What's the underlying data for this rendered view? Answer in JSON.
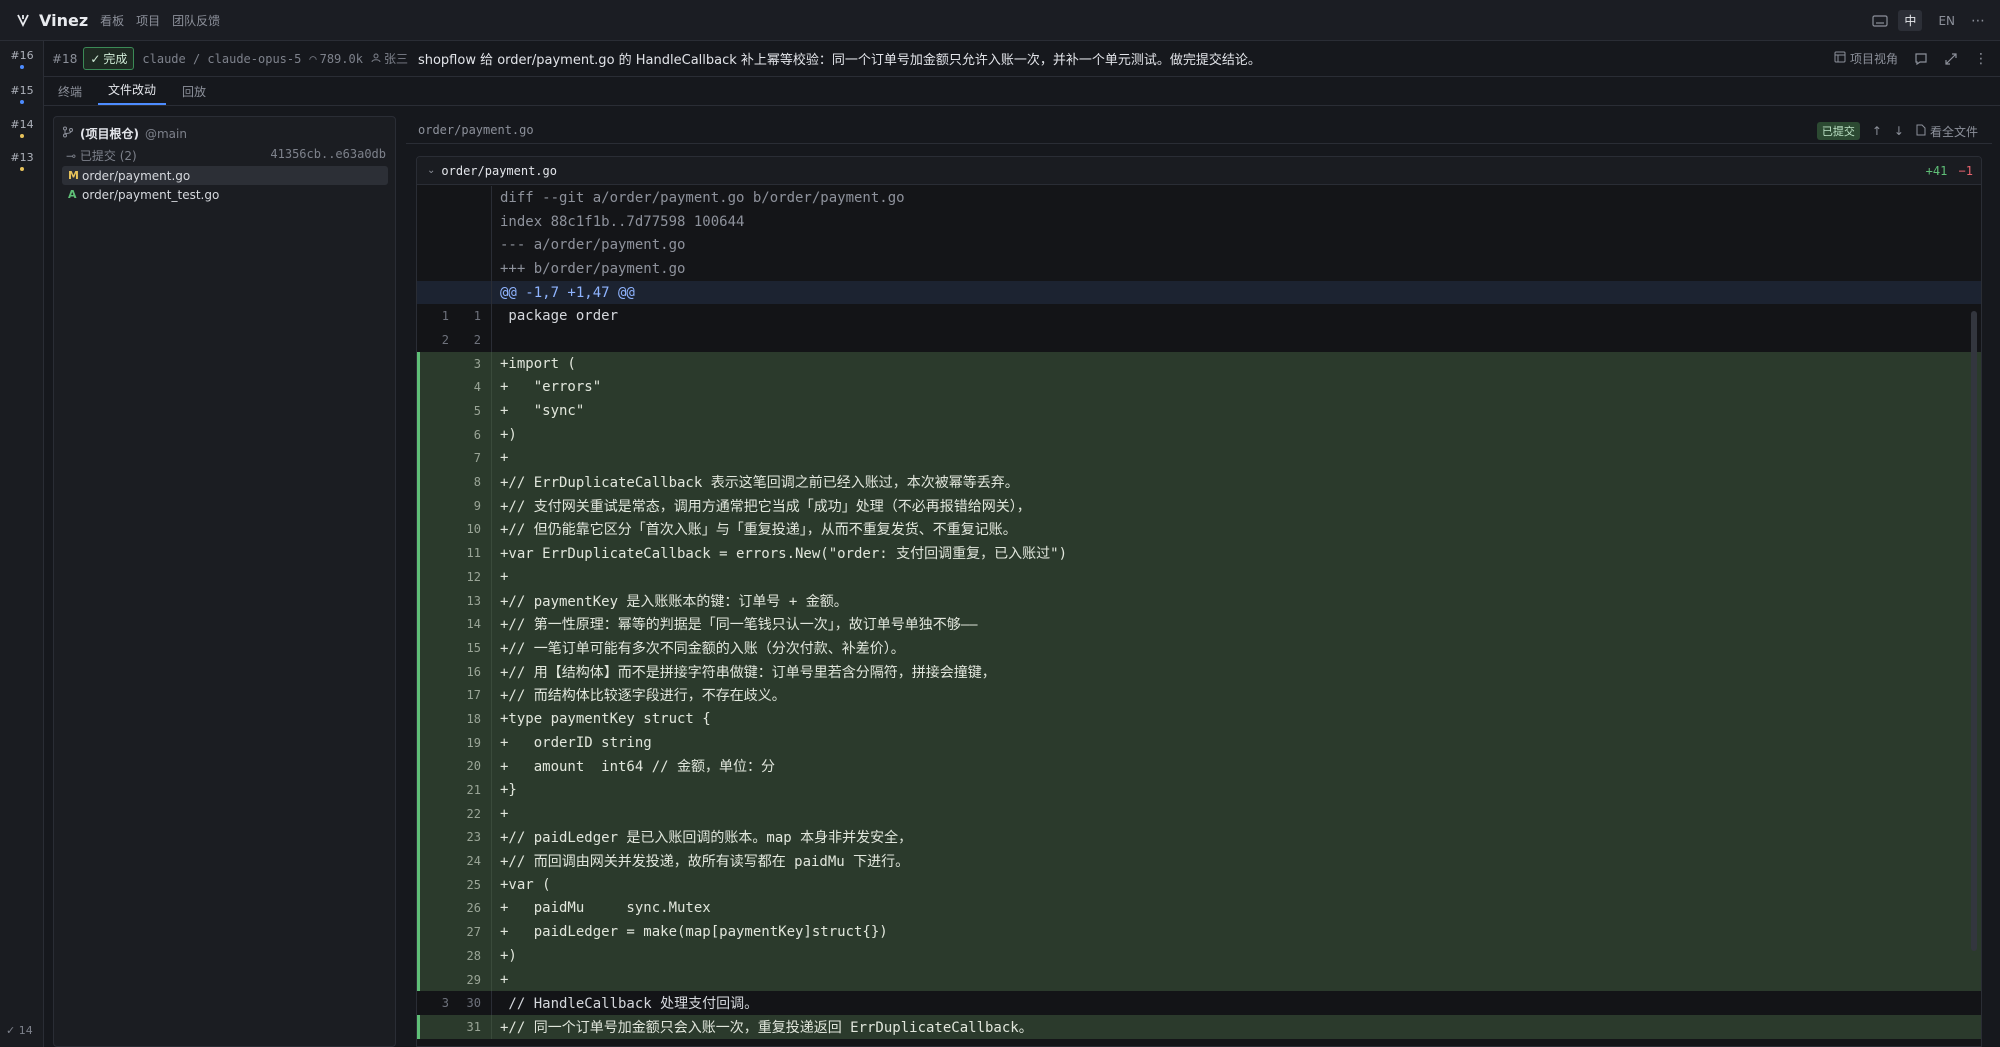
{
  "app": {
    "name": "Vinez",
    "nav": [
      "看板",
      "项目",
      "团队反馈"
    ],
    "lang_zh": "中",
    "lang_en": "EN"
  },
  "rail": {
    "items": [
      {
        "label": "#16",
        "dot": "#4d8cff"
      },
      {
        "label": "#15",
        "dot": "#4d8cff"
      },
      {
        "label": "#14",
        "dot": "#e6c15a"
      },
      {
        "label": "#13",
        "dot": "#e6c15a"
      }
    ],
    "count": "✓ 14"
  },
  "task": {
    "id": "#18",
    "status": "完成",
    "agent_path": "claude / claude-opus-5",
    "tokens": "789.0k",
    "owner": "张三",
    "title": "shopflow 给 order/payment.go 的 HandleCallback 补上幂等校验：同一个订单号加金额只允许入账一次，并补一个单元测试。做完提交结论。",
    "project_view": "项目视角"
  },
  "tabs": [
    "终端",
    "文件改动",
    "回放"
  ],
  "tree": {
    "root_name": "(项目根仓)",
    "branch": "@main",
    "commit_label": "已提交 (2)",
    "commit_range": "41356cb..e63a0db",
    "files": [
      {
        "status": "M",
        "name": "order/payment.go",
        "color": "#e6c15a"
      },
      {
        "status": "A",
        "name": "order/payment_test.go",
        "color": "#5fbf77"
      }
    ]
  },
  "diff": {
    "path": "order/payment.go",
    "badge": "已提交",
    "full_file": "看全文件",
    "file_name": "order/payment.go",
    "adds": "+41",
    "dels": "−1",
    "lines": [
      {
        "kind": "meta",
        "old": "",
        "new": "",
        "text": "diff --git a/order/payment.go b/order/payment.go"
      },
      {
        "kind": "meta",
        "old": "",
        "new": "",
        "text": "index 88c1f1b..7d77598 100644"
      },
      {
        "kind": "meta",
        "old": "",
        "new": "",
        "text": "--- a/order/payment.go"
      },
      {
        "kind": "meta",
        "old": "",
        "new": "",
        "text": "+++ b/order/payment.go"
      },
      {
        "kind": "hunk",
        "old": "",
        "new": "",
        "text": "@@ -1,7 +1,47 @@"
      },
      {
        "kind": "ctx",
        "old": "1",
        "new": "1",
        "text": " package order"
      },
      {
        "kind": "ctx",
        "old": "2",
        "new": "2",
        "text": " "
      },
      {
        "kind": "add",
        "old": "",
        "new": "3",
        "text": "+import ("
      },
      {
        "kind": "add",
        "old": "",
        "new": "4",
        "text": "+   \"errors\""
      },
      {
        "kind": "add",
        "old": "",
        "new": "5",
        "text": "+   \"sync\""
      },
      {
        "kind": "add",
        "old": "",
        "new": "6",
        "text": "+)"
      },
      {
        "kind": "add",
        "old": "",
        "new": "7",
        "text": "+"
      },
      {
        "kind": "add",
        "old": "",
        "new": "8",
        "text": "+// ErrDuplicateCallback 表示这笔回调之前已经入账过，本次被幂等丢弃。"
      },
      {
        "kind": "add",
        "old": "",
        "new": "9",
        "text": "+// 支付网关重试是常态，调用方通常把它当成「成功」处理（不必再报错给网关），"
      },
      {
        "kind": "add",
        "old": "",
        "new": "10",
        "text": "+// 但仍能靠它区分「首次入账」与「重复投递」，从而不重复发货、不重复记账。"
      },
      {
        "kind": "add",
        "old": "",
        "new": "11",
        "text": "+var ErrDuplicateCallback = errors.New(\"order: 支付回调重复，已入账过\")"
      },
      {
        "kind": "add",
        "old": "",
        "new": "12",
        "text": "+"
      },
      {
        "kind": "add",
        "old": "",
        "new": "13",
        "text": "+// paymentKey 是入账账本的键：订单号 + 金额。"
      },
      {
        "kind": "add",
        "old": "",
        "new": "14",
        "text": "+// 第一性原理：幂等的判据是「同一笔钱只认一次」，故订单号单独不够——"
      },
      {
        "kind": "add",
        "old": "",
        "new": "15",
        "text": "+// 一笔订单可能有多次不同金额的入账（分次付款、补差价）。"
      },
      {
        "kind": "add",
        "old": "",
        "new": "16",
        "text": "+// 用【结构体】而不是拼接字符串做键：订单号里若含分隔符，拼接会撞键，"
      },
      {
        "kind": "add",
        "old": "",
        "new": "17",
        "text": "+// 而结构体比较逐字段进行，不存在歧义。"
      },
      {
        "kind": "add",
        "old": "",
        "new": "18",
        "text": "+type paymentKey struct {"
      },
      {
        "kind": "add",
        "old": "",
        "new": "19",
        "text": "+   orderID string"
      },
      {
        "kind": "add",
        "old": "",
        "new": "20",
        "text": "+   amount  int64 // 金额，单位：分"
      },
      {
        "kind": "add",
        "old": "",
        "new": "21",
        "text": "+}"
      },
      {
        "kind": "add",
        "old": "",
        "new": "22",
        "text": "+"
      },
      {
        "kind": "add",
        "old": "",
        "new": "23",
        "text": "+// paidLedger 是已入账回调的账本。map 本身非并发安全，"
      },
      {
        "kind": "add",
        "old": "",
        "new": "24",
        "text": "+// 而回调由网关并发投递，故所有读写都在 paidMu 下进行。"
      },
      {
        "kind": "add",
        "old": "",
        "new": "25",
        "text": "+var ("
      },
      {
        "kind": "add",
        "old": "",
        "new": "26",
        "text": "+   paidMu     sync.Mutex"
      },
      {
        "kind": "add",
        "old": "",
        "new": "27",
        "text": "+   paidLedger = make(map[paymentKey]struct{})"
      },
      {
        "kind": "add",
        "old": "",
        "new": "28",
        "text": "+)"
      },
      {
        "kind": "add",
        "old": "",
        "new": "29",
        "text": "+"
      },
      {
        "kind": "ctx",
        "old": "3",
        "new": "30",
        "text": " // HandleCallback 处理支付回调。"
      },
      {
        "kind": "add",
        "old": "",
        "new": "31",
        "text": "+// 同一个订单号加金额只会入账一次，重复投递返回 ErrDuplicateCallback。"
      }
    ]
  }
}
